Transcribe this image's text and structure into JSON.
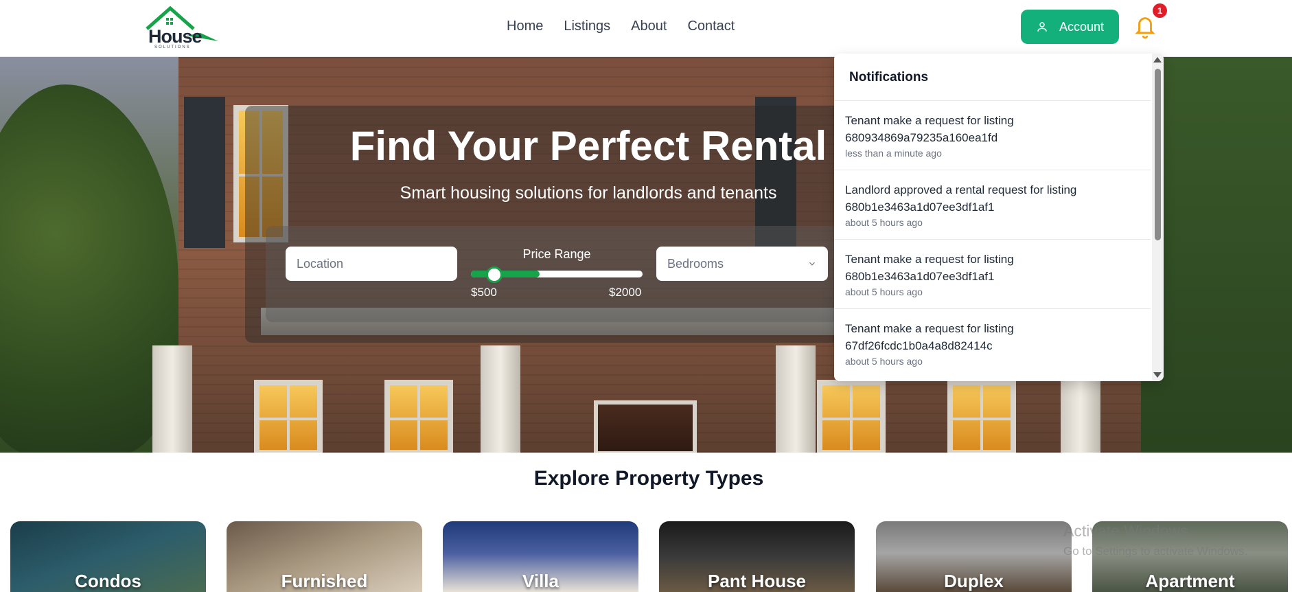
{
  "header": {
    "logo_word": "House",
    "logo_sub": "SOLUTIONS",
    "nav": [
      "Home",
      "Listings",
      "About",
      "Contact"
    ],
    "account_label": "Account",
    "notification_count": "1",
    "brand_color": "#14b07b",
    "bell_color": "#f59e0b",
    "badge_color": "#e11d2a"
  },
  "hero": {
    "title": "Find Your Perfect Rental",
    "subtitle": "Smart housing solutions for landlords and tenants",
    "search": {
      "location_placeholder": "Location",
      "price_label": "Price Range",
      "price_min": "$500",
      "price_max": "$2000",
      "price_fill_fraction": 0.4,
      "bedrooms_placeholder": "Bedrooms"
    }
  },
  "notifications": {
    "title": "Notifications",
    "items": [
      {
        "line1": "Tenant make a request for listing",
        "line2": "680934869a79235a160ea1fd",
        "time": "less than a minute ago"
      },
      {
        "line1": "Landlord approved a rental request for listing",
        "line2": "680b1e3463a1d07ee3df1af1",
        "time": "about 5 hours ago"
      },
      {
        "line1": "Tenant make a request for listing",
        "line2": "680b1e3463a1d07ee3df1af1",
        "time": "about 5 hours ago"
      },
      {
        "line1": "Tenant make a request for listing",
        "line2": "67df26fcdc1b0a4a8d82414c",
        "time": "about 5 hours ago"
      }
    ]
  },
  "explore": {
    "title": "Explore Property Types",
    "cards": [
      "Condos",
      "Furnished",
      "Villa",
      "Pant House",
      "Duplex",
      "Apartment"
    ]
  },
  "watermark": {
    "line1": "Activate Windows",
    "line2": "Go to Settings to activate Windows."
  }
}
